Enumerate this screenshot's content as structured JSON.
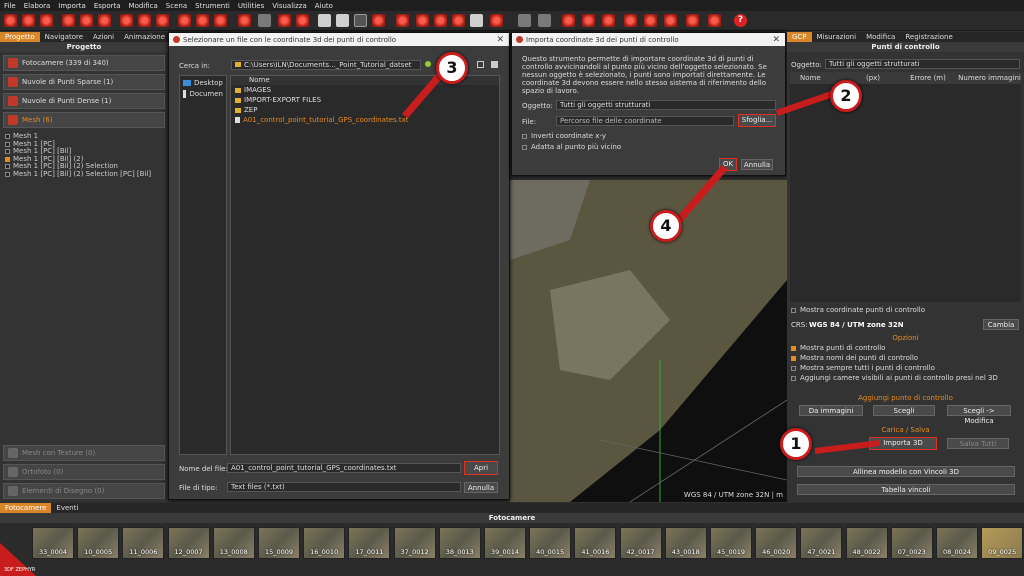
{
  "menu": [
    "File",
    "Elabora",
    "Importa",
    "Esporta",
    "Modifica",
    "Scena",
    "Strumenti",
    "Utilities",
    "Visualizza",
    "Aiuto"
  ],
  "left": {
    "tabs": [
      "Progetto",
      "Navigatore",
      "Azioni",
      "Animazione"
    ],
    "title": "Progetto",
    "groups": [
      "Fotocamere (339 di 340)",
      "Nuvole di Punti Sparse (1)",
      "Nuvole di Punti Dense (1)",
      "Mesh (6)"
    ],
    "meshes": [
      "Mesh 1",
      "Mesh 1 [PC]",
      "Mesh 1 [PC] [Bil]",
      "Mesh 1 [PC] [Bil] (2)",
      "Mesh 1 [PC] [Bil] (2) Selection",
      "Mesh 1 [PC] [Bil] (2) Selection [PC] [Bil]"
    ],
    "bottom_groups": [
      "Mesh con Texture (0)",
      "Ortofoto (0)",
      "Elementi di Disegno (0)"
    ]
  },
  "file_dialog": {
    "title": "Selezionare un file con le coordinate 3d dei punti di controllo",
    "lookin_label": "Cerca in:",
    "path": "C:\\Users\\ILN\\Documents..._Point_Tutorial_datset",
    "places": [
      "Desktop",
      "Documen"
    ],
    "col_name": "Nome",
    "files": [
      "IMAGES",
      "IMPORT-EXPORT FILES",
      "ZEP",
      "A01_control_point_tutorial_GPS_coordinates.txt"
    ],
    "filename_label": "Nome del file:",
    "filename": "A01_control_point_tutorial_GPS_coordinates.txt",
    "filetype_label": "File di tipo:",
    "filetype": "Text files (*.txt)",
    "open": "Apri",
    "cancel": "Annulla"
  },
  "import_dialog": {
    "title": "Importa coordinate 3d dei punti di controllo",
    "description": "Questo strumento permette di importare coordinate 3d di punti di controllo avvicinandoli al punto più vicino dell'oggetto selezionato. Se nessun oggetto è selezionato, i punti sono importati direttamente. Le coordinate 3d devono essere nello stesso sistema di riferimento dello spazio di lavoro.",
    "object_label": "Oggetto:",
    "object_value": "Tutti gli oggetti strutturati",
    "file_label": "File:",
    "file_placeholder": "Percorso file delle coordinate",
    "browse": "Sfoglia...",
    "invert": "Inverti coordinate x-y",
    "adapt": "Adatta al punto più vicino",
    "ok": "OK",
    "cancel": "Annulla"
  },
  "viewport": {
    "status": "WGS 84 / UTM zone 32N | m"
  },
  "right": {
    "tabs": [
      "GCP",
      "Misurazioni",
      "Modifica",
      "Registrazione"
    ],
    "title": "Punti di controllo",
    "object_label": "Oggetto:",
    "object_value": "Tutti gli oggetti strutturati",
    "columns": [
      "Nome",
      "(px)",
      "Errore (m)",
      "Numero immagini"
    ],
    "show_coords": "Mostra coordinate punti di controllo",
    "crs_label": "CRS:",
    "crs_value": "WGS 84 / UTM zone 32N",
    "change": "Cambia",
    "options_title": "Opzioni",
    "options": [
      "Mostra punti di controllo",
      "Mostra nomi dei punti di controllo",
      "Mostra sempre tutti i punti di controllo",
      "Aggiungi camere visibili ai punti di controllo presi nel 3D"
    ],
    "add_title": "Aggiungi punto di controllo",
    "add_buttons": [
      "Da immagini",
      "Scegli",
      "Scegli -> Modifica"
    ],
    "load_title": "Carica / Salva",
    "import": "Importa 3D",
    "save_all": "Salva Tutti",
    "align": "Allinea modello con Vincoli 3D",
    "table": "Tabella vincoli"
  },
  "bottom": {
    "tabs": [
      "Fotocamere",
      "Eventi"
    ],
    "title": "Fotocamere",
    "thumbs": [
      "33_0004",
      "10_0005",
      "11_0006",
      "12_0007",
      "13_0008",
      "15_0009",
      "16_0010",
      "17_0011",
      "37_0012",
      "38_0013",
      "39_0014",
      "40_0015",
      "41_0016",
      "42_0017",
      "43_0018",
      "45_0019",
      "46_0020",
      "47_0021",
      "48_0022",
      "07_0023",
      "08_0024",
      "09_0025"
    ],
    "brand": "3DF ZEPHYR"
  },
  "callouts": [
    "1",
    "2",
    "3",
    "4"
  ],
  "colors": {
    "accent": "#d9862a",
    "highlight": "#e03020"
  }
}
